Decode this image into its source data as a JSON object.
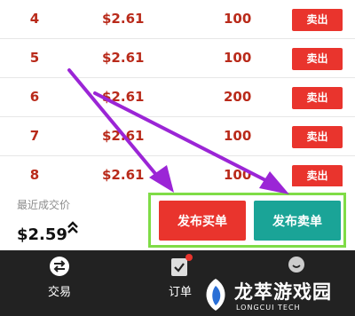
{
  "orders": [
    {
      "index": "4",
      "price": "$2.61",
      "qty": "100",
      "sell": "卖出"
    },
    {
      "index": "5",
      "price": "$2.61",
      "qty": "100",
      "sell": "卖出"
    },
    {
      "index": "6",
      "price": "$2.61",
      "qty": "200",
      "sell": "卖出"
    },
    {
      "index": "7",
      "price": "$2.61",
      "qty": "100",
      "sell": "卖出"
    },
    {
      "index": "8",
      "price": "$2.61",
      "qty": "100",
      "sell": "卖出"
    }
  ],
  "last_trade": {
    "label": "最近成交价",
    "price": "$2.59",
    "trend_icon": "double-chevron-up-icon"
  },
  "publish_buttons": {
    "red": "发布买单",
    "teal": "发布卖单"
  },
  "tabs": [
    {
      "label": "交易",
      "icon": "swap-arrows-icon"
    },
    {
      "label": "订单",
      "icon": "clipboard-check-icon",
      "has_notification": true
    },
    {
      "label": "",
      "icon": "smiley-icon"
    }
  ],
  "watermark": {
    "text": "龙萃游戏园",
    "sub": "LONGCUI TECH"
  },
  "colors": {
    "accent_red": "#e9342d",
    "accent_teal": "#1aa497",
    "highlight_green": "#7fdc46",
    "annotation_purple": "#9b25d6",
    "tabbar": "#222222"
  }
}
